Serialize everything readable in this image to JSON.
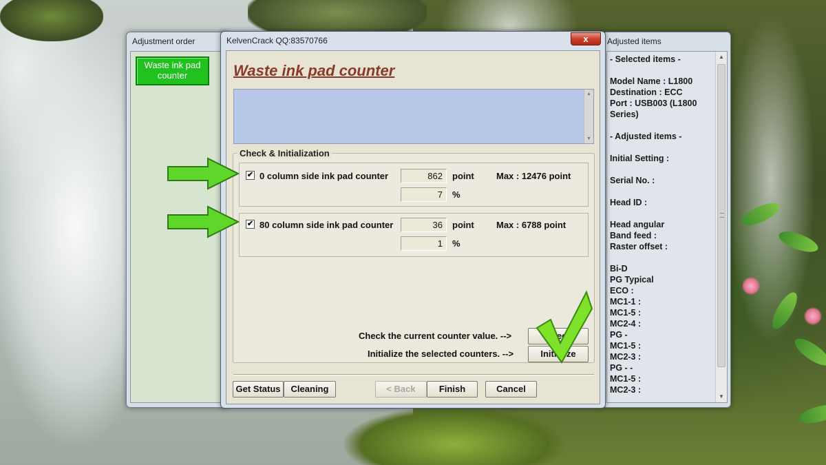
{
  "windows": {
    "adjustment_order": {
      "title": "Adjustment order",
      "active_item": "Waste ink pad counter"
    },
    "main": {
      "title": "KelvenCrack  QQ:83570766",
      "close_glyph": "x",
      "heading": "Waste ink pad counter",
      "group_title": "Check & Initialization",
      "counters": [
        {
          "checked": true,
          "check_glyph": "✔",
          "label": "0 column side ink pad counter",
          "point_value": "862",
          "point_unit": "point",
          "percent_value": "7",
          "percent_unit": "%",
          "max": "Max : 12476 point"
        },
        {
          "checked": true,
          "check_glyph": "✔",
          "label": "80 column side ink pad counter",
          "point_value": "36",
          "point_unit": "point",
          "percent_value": "1",
          "percent_unit": "%",
          "max": "Max : 6788 point"
        }
      ],
      "check_hint": "Check the current counter value. -->",
      "check_button": "Check",
      "init_hint": "Initialize the selected counters. -->",
      "init_button": "Initialize",
      "footer_buttons": {
        "get_status": "Get Status",
        "cleaning": "Cleaning",
        "back": "< Back",
        "finish": "Finish",
        "cancel": "Cancel"
      }
    },
    "adjusted_items": {
      "title": "Adjusted items",
      "lines": [
        "- Selected items -",
        "",
        "Model Name : L1800",
        "Destination : ECC",
        "Port : USB003 (L1800",
        "Series)",
        "",
        "- Adjusted items -",
        "",
        "Initial Setting :",
        "",
        "Serial No. :",
        "",
        "Head ID :",
        "",
        "Head angular",
        " Band feed :",
        " Raster offset :",
        "",
        "Bi-D",
        "PG Typical",
        " ECO   :",
        " MC1-1 :",
        " MC1-5 :",
        " MC2-4 :",
        "PG -",
        " MC1-5 :",
        " MC2-3 :",
        "PG - -",
        " MC1-5 :",
        " MC2-3 :"
      ]
    }
  },
  "overlay_colors": {
    "arrow": "#5ed62a",
    "checkmark": "#7ee22a"
  }
}
